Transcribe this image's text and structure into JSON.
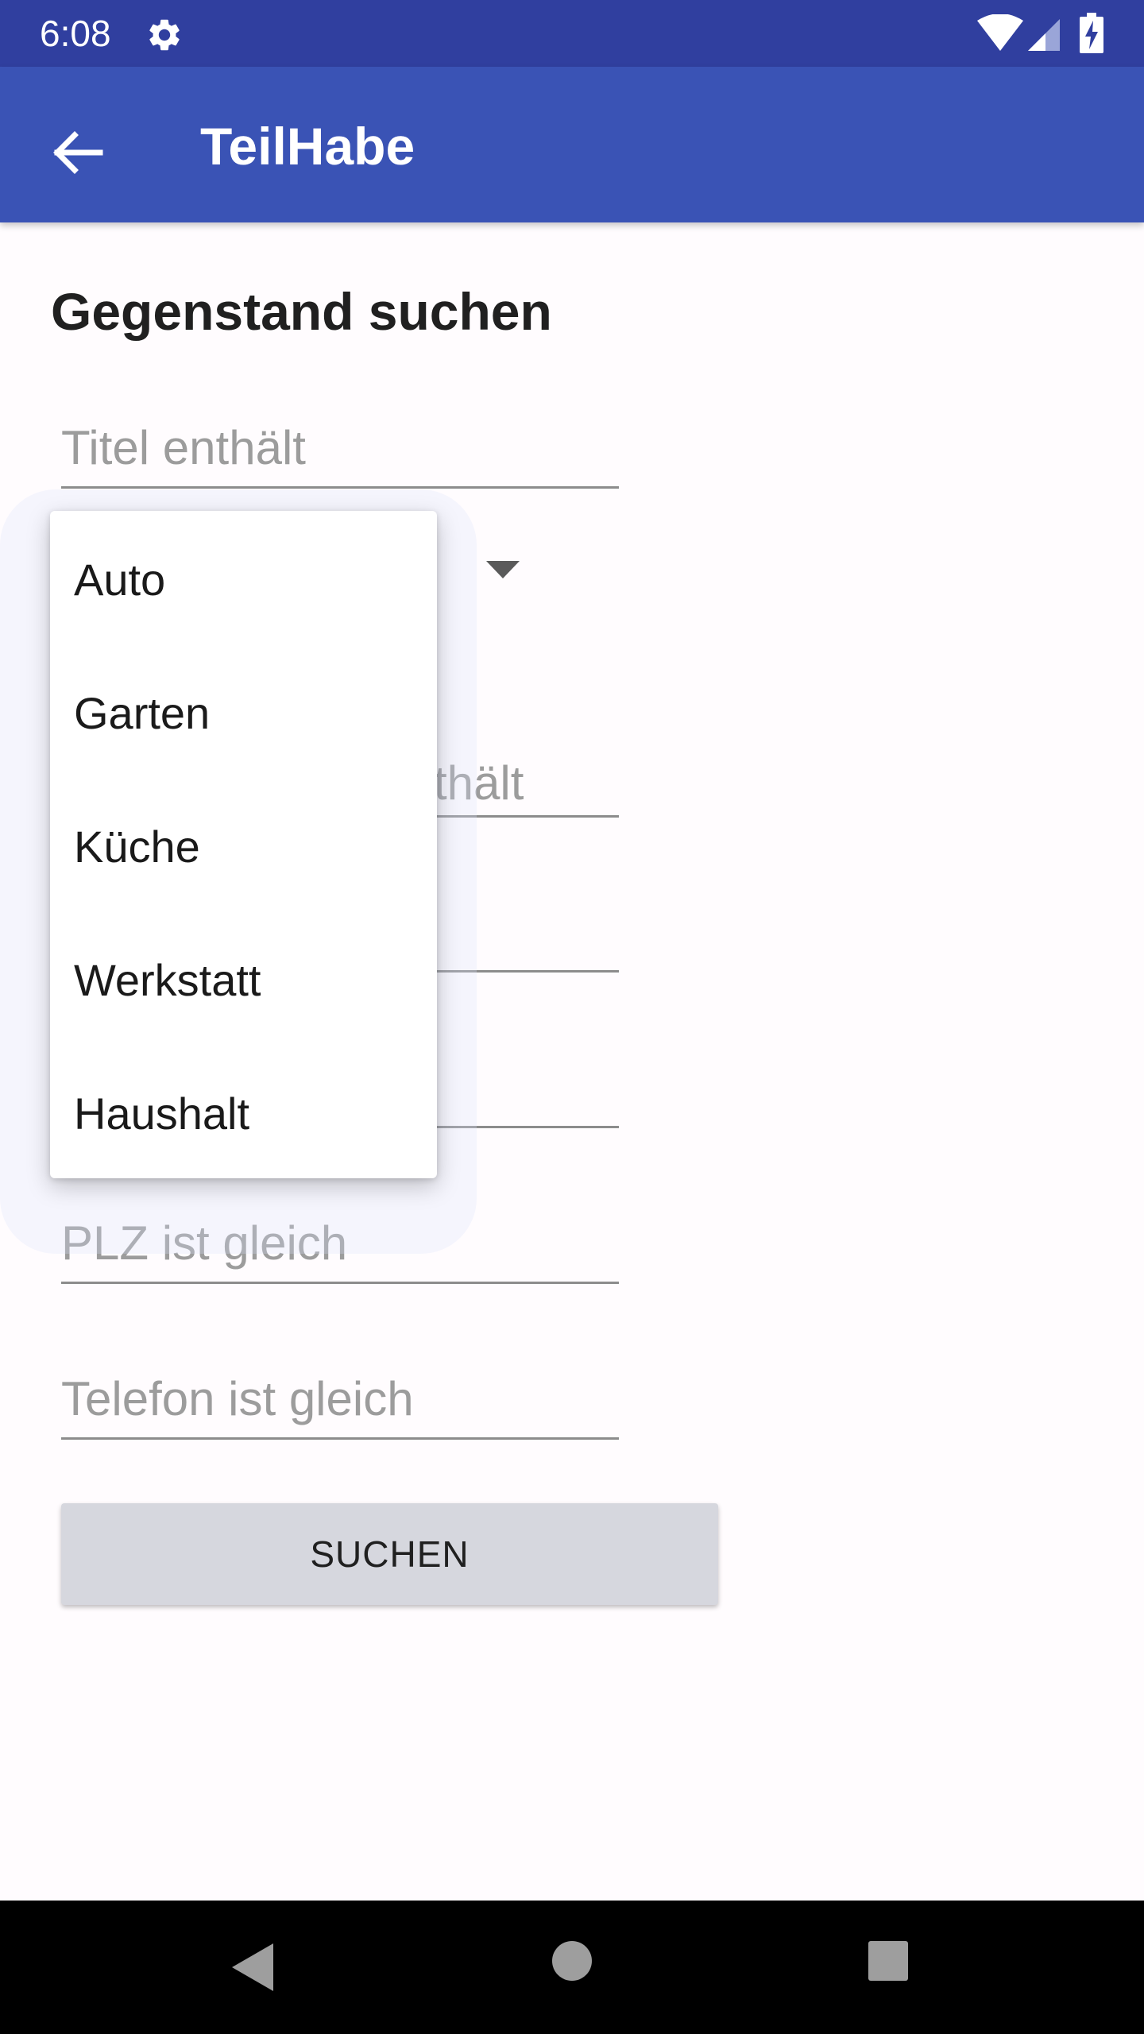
{
  "status_bar": {
    "time": "6:08",
    "icons": [
      "gear-icon",
      "wifi-icon",
      "signal-icon",
      "battery-charging-icon"
    ]
  },
  "app_bar": {
    "title": "TeilHabe",
    "back_icon": "arrow-back-icon"
  },
  "page": {
    "heading": "Gegenstand suchen"
  },
  "form": {
    "title_placeholder": "Titel enthält",
    "description_placeholder_visible": "thält",
    "plz_placeholder": "PLZ ist gleich",
    "phone_placeholder": "Telefon ist gleich",
    "search_button": "SUCHEN"
  },
  "category_dropdown": {
    "options": [
      "Auto",
      "Garten",
      "Küche",
      "Werkstatt",
      "Haushalt"
    ]
  },
  "nav_bar": {
    "icons": [
      "nav-back-icon",
      "nav-home-icon",
      "nav-recents-icon"
    ]
  },
  "colors": {
    "status_bar": "#303f9f",
    "app_bar": "#3a53b5",
    "background": "#fffcfe",
    "button": "#d6d7de"
  }
}
